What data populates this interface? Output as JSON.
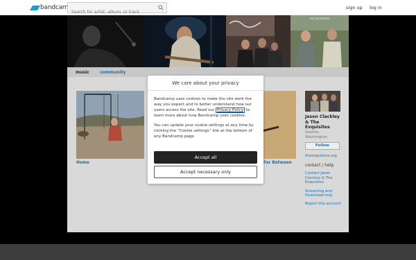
{
  "header": {
    "logo_text": "bandcamp",
    "search_placeholder": "Search for artist, album, or track",
    "signup_label": "sign up",
    "login_label": "log in"
  },
  "tabs": [
    {
      "label": "music"
    },
    {
      "label": "community"
    }
  ],
  "albums": [
    {
      "title": "Home"
    },
    {
      "title": "Far Between"
    }
  ],
  "artist": {
    "name_line1": "Jason Clackley",
    "name_line2": "& The",
    "name_line3": "Exquisites",
    "location_line1": "Seattle,",
    "location_line2": "Washington",
    "follow_label": "Follow",
    "website": "theexquisites.org",
    "contact_heading": "contact / help",
    "contact_link_1": "Contact Jason",
    "contact_link_2": "Clackley & The",
    "contact_link_3": "Exquisites",
    "help_link_1": "Streaming and",
    "help_link_2": "Download help",
    "report_link": "Report this account"
  },
  "cookie_dialog": {
    "title": "We care about your privacy",
    "para1_a": "Bandcamp uses cookies to make the site work the way you expect and to better understand how our users access the site. Read our ",
    "para1_link": "Privacy Policy",
    "para1_b": " to learn more about how Bandcamp uses cookies.",
    "para2": "You can update your cookie settings at any time by clicking the “Cookie settings” link at the bottom of any Bandcamp page.",
    "accept_all_label": "Accept all",
    "accept_necessary_label": "Accept necessary only"
  },
  "colors": {
    "accent": "#1da0c3",
    "link": "#1a6fb0",
    "button_dark": "#232323"
  }
}
